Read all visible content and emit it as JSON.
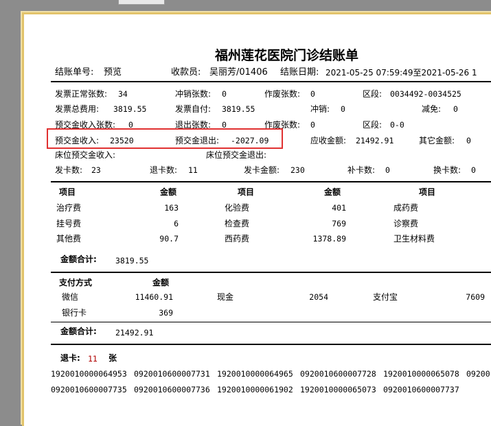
{
  "title": "福州莲花医院门诊结账单",
  "header": {
    "bill_no_label": "结账单号:",
    "bill_no": "预览",
    "cashier_label": "收款员:",
    "cashier": "吴丽芳/01406",
    "date_label": "结账日期:",
    "date_range": "2021-05-25 07:59:49至2021-05-26 1"
  },
  "summary": {
    "normal_invoice_label": "发票正常张数:",
    "normal_invoice": "34",
    "offset_count_label": "冲销张数:",
    "offset_count": "0",
    "void_count_label": "作废张数:",
    "void_count": "0",
    "range_label": "区段:",
    "range": "0034492-0034525",
    "invoice_total_label": "发票总费用:",
    "invoice_total": "3819.55",
    "self_pay_label": "发票自付:",
    "self_pay": "3819.55",
    "offset_label": "冲销:",
    "offset": "0",
    "reduce_label": "减免:",
    "reduce": "0",
    "prepay_count_label": "预交金收入张数:",
    "prepay_count": "0",
    "refund_count_label": "退出张数:",
    "refund_count": "0",
    "void_count2_label": "作废张数:",
    "void_count2": "0",
    "range2_label": "区段:",
    "range2": "0-0",
    "prepay_income_label": "预交金收入:",
    "prepay_income": "23520",
    "prepay_refund_label": "预交金退出:",
    "prepay_refund": "-2027.09",
    "receivable_label": "应收金额:",
    "receivable": "21492.91",
    "other_label": "其它金额:",
    "other": "0",
    "bed_prepay_income_label": "床位预交金收入:",
    "bed_prepay_refund_label": "床位预交金退出:",
    "card_issued_label": "发卡数:",
    "card_issued": "23",
    "card_returned_label": "退卡数:",
    "card_returned": "11",
    "card_amount_label": "发卡金额:",
    "card_amount": "230",
    "card_reissue_label": "补卡数:",
    "card_reissue": "0",
    "card_swap_label": "换卡数:",
    "card_swap": "0"
  },
  "items": {
    "col_item": "项目",
    "col_amount": "金额",
    "rows": [
      [
        {
          "name": "治疗费",
          "amount": "163"
        },
        {
          "name": "化验费",
          "amount": "401"
        },
        {
          "name": "成药费",
          "amount": ""
        }
      ],
      [
        {
          "name": "挂号费",
          "amount": "6"
        },
        {
          "name": "检查费",
          "amount": "769"
        },
        {
          "name": "诊察费",
          "amount": ""
        }
      ],
      [
        {
          "name": "其他费",
          "amount": "90.7"
        },
        {
          "name": "西药费",
          "amount": "1378.89"
        },
        {
          "name": "卫生材料费",
          "amount": ""
        }
      ]
    ],
    "total_label": "金额合计:",
    "total": "3819.55"
  },
  "payments": {
    "col_method": "支付方式",
    "col_amount": "金额",
    "rows": [
      {
        "method": "微信",
        "amount": "11460.91"
      },
      {
        "method": "现金",
        "amount": "2054"
      },
      {
        "method": "支付宝",
        "amount": "7609"
      },
      {
        "method": "银行卡",
        "amount": "369"
      }
    ],
    "total_label": "金额合计:",
    "total": "21492.91"
  },
  "refund_cards": {
    "label": "退卡:",
    "count": "11",
    "unit": "张",
    "numbers": [
      "192001000006495 3",
      "092001060000773 1",
      "192001000006496 5",
      "092001060000772 8",
      "192001000006507 8",
      "09200",
      "092001060000773 5",
      "092001060000773 6",
      "192001000006190 2",
      "192001000006507 3",
      "092001060000773 7"
    ],
    "numbers_display": [
      "1920010000064953",
      "0920010600007731",
      "1920010000064965",
      "0920010600007728",
      "1920010000065078",
      "09200",
      "0920010600007735",
      "0920010600007736",
      "1920010000061902",
      "1920010000065073",
      "0920010600007737"
    ]
  }
}
